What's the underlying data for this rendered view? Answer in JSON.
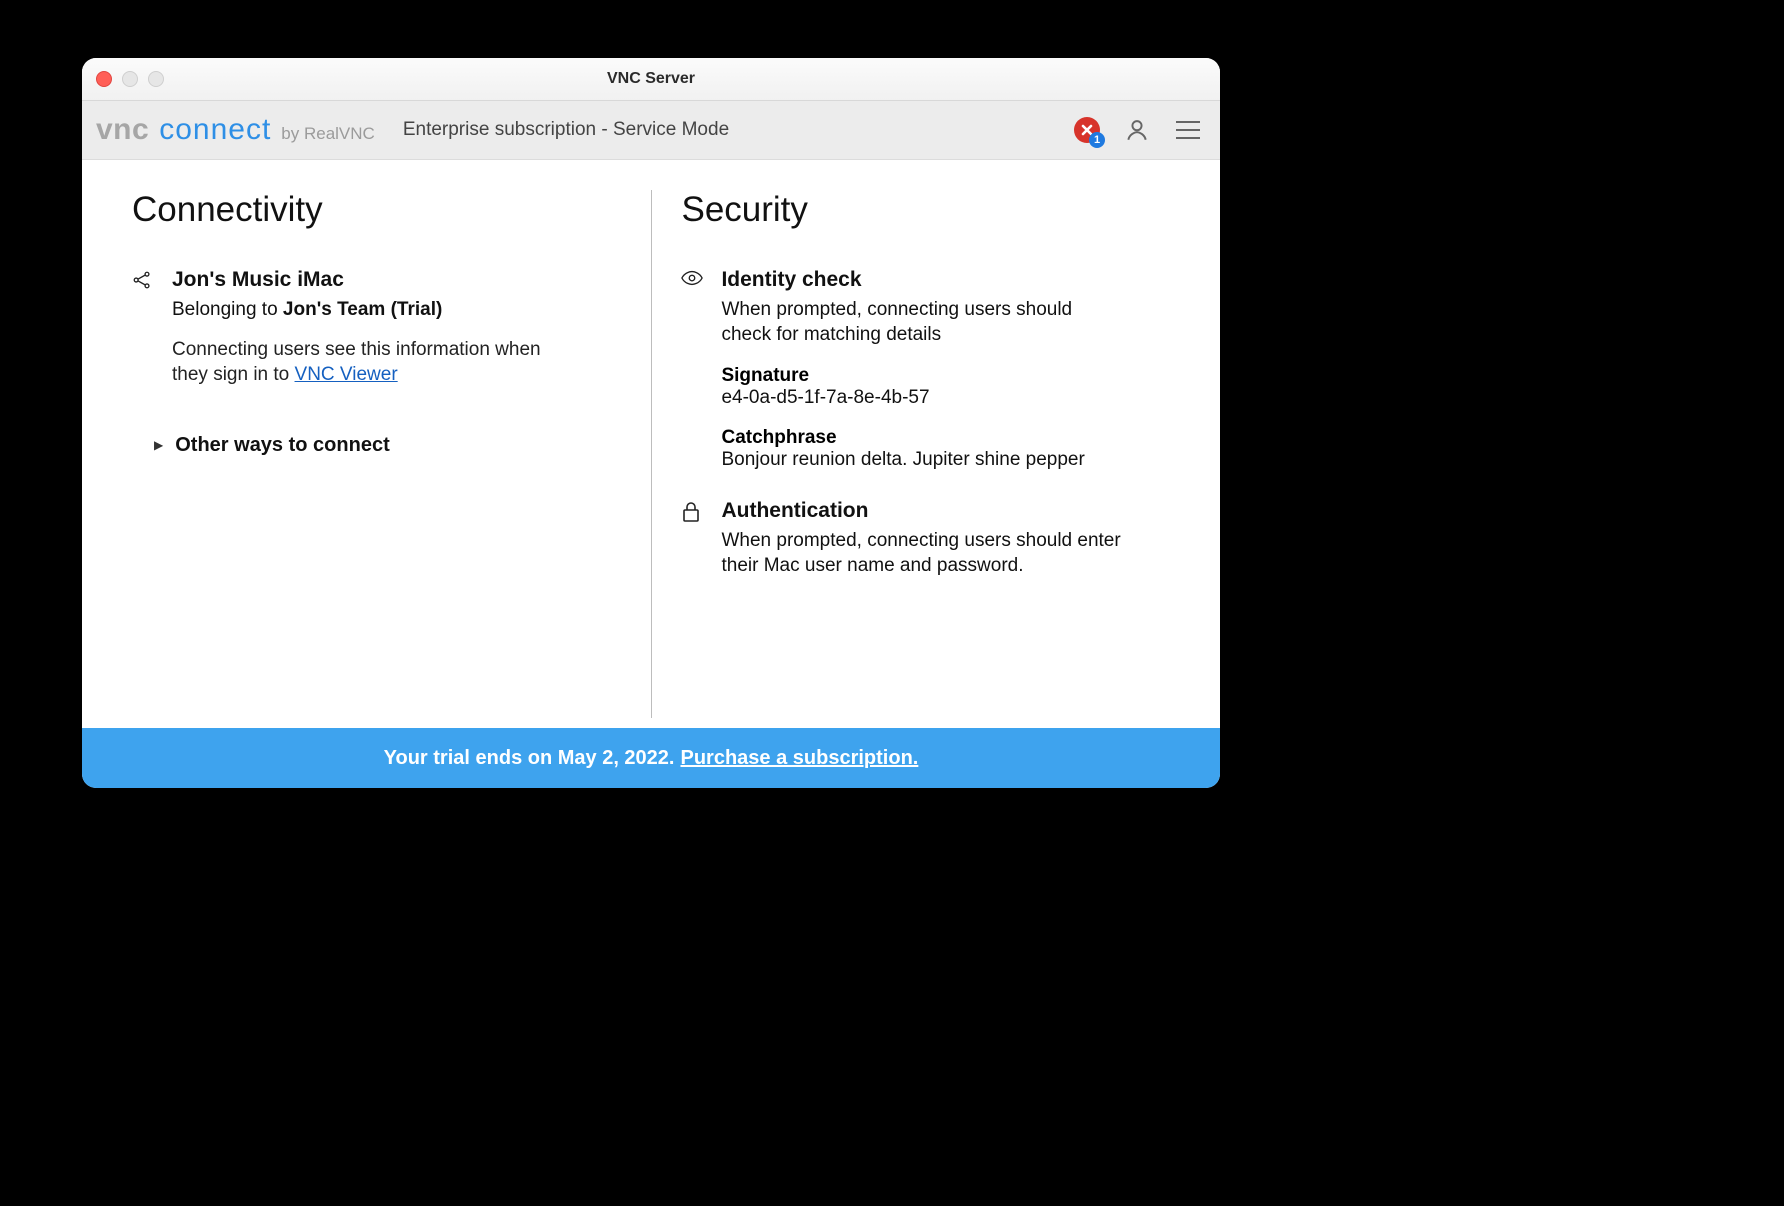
{
  "window": {
    "title": "VNC Server"
  },
  "header": {
    "logo": {
      "vnc": "vnc",
      "connect": "connect",
      "by": "by RealVNC"
    },
    "subtitle": "Enterprise subscription - Service Mode",
    "notif_badge": "1"
  },
  "connectivity": {
    "heading": "Connectivity",
    "device_name": "Jon's Music iMac",
    "belonging_prefix": "Belonging to ",
    "belonging_team": "Jon's Team (Trial)",
    "info_line": "Connecting users see this information when they sign in to ",
    "viewer_link": "VNC Viewer",
    "other_ways": "Other ways to connect"
  },
  "security": {
    "heading": "Security",
    "identity": {
      "title": "Identity check",
      "desc": "When prompted, connecting users should check for matching details",
      "signature_label": "Signature",
      "signature_value": "e4-0a-d5-1f-7a-8e-4b-57",
      "catchphrase_label": "Catchphrase",
      "catchphrase_value": "Bonjour reunion delta. Jupiter shine pepper"
    },
    "auth": {
      "title": "Authentication",
      "desc": "When prompted, connecting users should enter their Mac user name and password."
    }
  },
  "footer": {
    "text": "Your trial ends on May 2, 2022. ",
    "link": "Purchase a subscription."
  }
}
